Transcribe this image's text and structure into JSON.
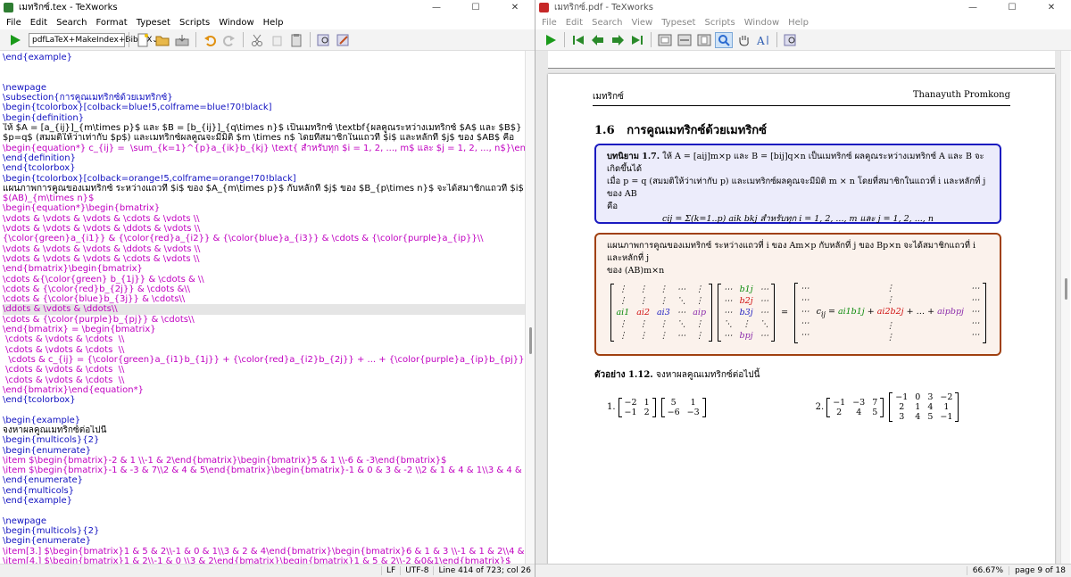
{
  "editor_window": {
    "title": "เมทริกซ์.tex - TeXworks",
    "menu": [
      "File",
      "Edit",
      "Search",
      "Format",
      "Typeset",
      "Scripts",
      "Window",
      "Help"
    ],
    "typeset_engine": "pdfLaTeX+MakeIndex+BibTeX",
    "status": {
      "line_ending": "LF",
      "encoding": "UTF-8",
      "position": "Line 414 of 723; col 26"
    },
    "lines": [
      {
        "t": "\\end{example}",
        "k": "cmd"
      },
      {
        "t": "",
        "k": "txt"
      },
      {
        "t": "",
        "k": "txt"
      },
      {
        "t": "\\newpage",
        "k": "cmd"
      },
      {
        "t": "\\subsection{การคูณเมทริกซ์ด้วยเมทริกซ์}",
        "k": "cmd"
      },
      {
        "t": "\\begin{tcolorbox}[colback=blue!5,colframe=blue!70!black]",
        "k": "cmd"
      },
      {
        "t": "\\begin{definition}",
        "k": "cmd"
      },
      {
        "t": "ให้ $A = [a_{ij}]_{m\\times p}$ และ $B = [b_{ij}]_{q\\times n}$ เป็นเมทริกซ์ \\textbf{ผลคูณระหว่างเมทริกซ์ $A$ และ $B$} จะเกิดขึ้นได้เมื่อ",
        "k": "txt"
      },
      {
        "t": "$p=q$ (สมมติให้ว่าเท่ากับ $p$) และเมทริกซ์ผลคูณจะมีมิติ $m \\times n$ โดยที่สมาชิกในแถวที่ $i$ และหลักที่ $j$ ของ $AB$ คือ",
        "k": "txt"
      },
      {
        "t": "\\begin{equation*} c_{ij} =  \\sum_{k=1}^{p}a_{ik}b_{kj} \\text{ สำหรับทุก $i = 1, 2, ..., m$ และ $j = 1, 2, ..., n$}\\end{equation*}",
        "k": "math"
      },
      {
        "t": "\\end{definition}",
        "k": "cmd"
      },
      {
        "t": "\\end{tcolorbox}",
        "k": "cmd"
      },
      {
        "t": "\\begin{tcolorbox}[colback=orange!5,colframe=orange!70!black]",
        "k": "cmd"
      },
      {
        "t": "แผนภาพการคูณของเมทริกซ์ ระหว่างแถวที่ $i$ ของ $A_{m\\times p}$ กับหลักที่ $j$ ของ $B_{p\\times n}$ จะได้สมาชิกแถวที่ $i$ และหลักที่ $j$ ของ",
        "k": "txt"
      },
      {
        "t": "$(AB)_{m\\times n}$",
        "k": "math"
      },
      {
        "t": "\\begin{equation*}\\begin{bmatrix}",
        "k": "math"
      },
      {
        "t": "\\vdots & \\vdots & \\vdots & \\cdots & \\vdots \\\\",
        "k": "math"
      },
      {
        "t": "\\vdots & \\vdots & \\vdots & \\ddots & \\vdots \\\\",
        "k": "math"
      },
      {
        "t": "{\\color{green}a_{i1}} & {\\color{red}a_{i2}} & {\\color{blue}a_{i3}} & \\cdots & {\\color{purple}a_{ip}}\\\\",
        "k": "math"
      },
      {
        "t": "\\vdots & \\vdots & \\vdots & \\ddots & \\vdots \\\\",
        "k": "math"
      },
      {
        "t": "\\vdots & \\vdots & \\vdots & \\cdots & \\vdots \\\\",
        "k": "math"
      },
      {
        "t": "\\end{bmatrix}\\begin{bmatrix}",
        "k": "math"
      },
      {
        "t": "\\cdots &{\\color{green} b_{1j}} & \\cdots & \\\\",
        "k": "math"
      },
      {
        "t": "\\cdots & {\\color{red}b_{2j}} & \\cdots &\\\\",
        "k": "math"
      },
      {
        "t": "\\cdots & {\\color{blue}b_{3j}} & \\cdots\\\\",
        "k": "math"
      },
      {
        "t": "\\ddots & \\vdots & \\ddots\\\\",
        "k": "math"
      },
      {
        "t": "\\cdots & {\\color{purple}b_{pj}} & \\cdots\\\\",
        "k": "math"
      },
      {
        "t": "\\end{bmatrix} = \\begin{bmatrix}",
        "k": "math"
      },
      {
        "t": " \\cdots & \\vdots & \\cdots  \\\\",
        "k": "math"
      },
      {
        "t": " \\cdots & \\vdots & \\cdots  \\\\",
        "k": "math"
      },
      {
        "t": "  \\cdots & c_{ij} = {\\color{green}a_{i1}b_{1j}} + {\\color{red}a_{i2}b_{2j}} + ... + {\\color{purple}a_{ip}b_{pj}} & \\cdots \\\\",
        "k": "math"
      },
      {
        "t": " \\cdots & \\vdots & \\cdots  \\\\",
        "k": "math"
      },
      {
        "t": " \\cdots & \\vdots & \\cdots  \\\\",
        "k": "math"
      },
      {
        "t": "\\end{bmatrix}\\end{equation*}",
        "k": "math"
      },
      {
        "t": "\\end{tcolorbox}",
        "k": "cmd"
      },
      {
        "t": "",
        "k": "txt"
      },
      {
        "t": "\\begin{example}",
        "k": "cmd"
      },
      {
        "t": "จงหาผลคูณเมทริกซ์ต่อไปนี้",
        "k": "txt"
      },
      {
        "t": "\\begin{multicols}{2}",
        "k": "cmd"
      },
      {
        "t": "\\begin{enumerate}",
        "k": "cmd"
      },
      {
        "t": "\\item $\\begin{bmatrix}-2 & 1 \\\\-1 & 2\\end{bmatrix}\\begin{bmatrix}5 & 1 \\\\-6 & -3\\end{bmatrix}$",
        "k": "math"
      },
      {
        "t": "\\item $\\begin{bmatrix}-1 & -3 & 7\\\\2 & 4 & 5\\end{bmatrix}\\begin{bmatrix}-1 & 0 & 3 & -2 \\\\2 & 1 & 4 & 1\\\\3 & 4 & 5 & -1\\end{bmatrix}$",
        "k": "math"
      },
      {
        "t": "\\end{enumerate}",
        "k": "cmd"
      },
      {
        "t": "\\end{multicols}",
        "k": "cmd"
      },
      {
        "t": "\\end{example}",
        "k": "cmd"
      },
      {
        "t": "",
        "k": "txt"
      },
      {
        "t": "\\newpage",
        "k": "cmd"
      },
      {
        "t": "\\begin{multicols}{2}",
        "k": "cmd"
      },
      {
        "t": "\\begin{enumerate}",
        "k": "cmd"
      },
      {
        "t": "\\item[3.] $\\begin{bmatrix}1 & 5 & 2\\\\-1 & 0 & 1\\\\3 & 2 & 4\\end{bmatrix}\\begin{bmatrix}6 & 1 & 3 \\\\-1 & 1 & 2\\\\4 & 1 & 3\\end{bmatrix}$",
        "k": "math"
      },
      {
        "t": "\\item[4.] $\\begin{bmatrix}1 & 2\\\\-1 & 0 \\\\3 & 2\\end{bmatrix}\\begin{bmatrix}1 & 5 & 2\\\\-2 &0&1\\end{bmatrix}$",
        "k": "math"
      }
    ]
  },
  "viewer_window": {
    "title": "เมทริกซ์.pdf - TeXworks",
    "menu": [
      "File",
      "Edit",
      "Search",
      "View",
      "Typeset",
      "Scripts",
      "Window",
      "Help"
    ],
    "status": {
      "zoom": "66.67%",
      "page": "page 9 of 18"
    },
    "page": {
      "header_left": "เมทริกซ์",
      "header_right": "Thanayuth Promkong",
      "section_number": "1.6",
      "section_title": "การคูณเมทริกซ์ด้วยเมทริกซ์",
      "def_label": "บทนิยาม 1.7.",
      "def_line1": "ให้ A = [aij]m×p และ B = [bij]q×n เป็นเมทริกซ์ ผลคูณระหว่างเมทริกซ์ A และ B จะเกิดขึ้นได้",
      "def_line2": "เมื่อ p = q (สมมติให้ว่าเท่ากับ p) และเมทริกซ์ผลคูณจะมีมิติ m × n โดยที่สมาชิกในแถวที่ i และหลักที่ j ของ AB",
      "def_line3": "คือ",
      "def_formula": "cij = Σ(k=1..p) aik bkj  สำหรับทุก i = 1, 2, ..., m และ j = 1, 2, ..., n",
      "diag_line1": "แผนภาพการคูณของเมทริกซ์ ระหว่างแถวที่ i ของ Am×p กับหลักที่ j ของ Bp×n จะได้สมาชิกแถวที่ i และหลักที่ j",
      "diag_line2": "ของ (AB)m×n",
      "example_label": "ตัวอย่าง 1.12.",
      "example_text": "จงหาผลคูณเมทริกซ์ต่อไปนี้",
      "item1": "1.",
      "item2": "2."
    }
  }
}
